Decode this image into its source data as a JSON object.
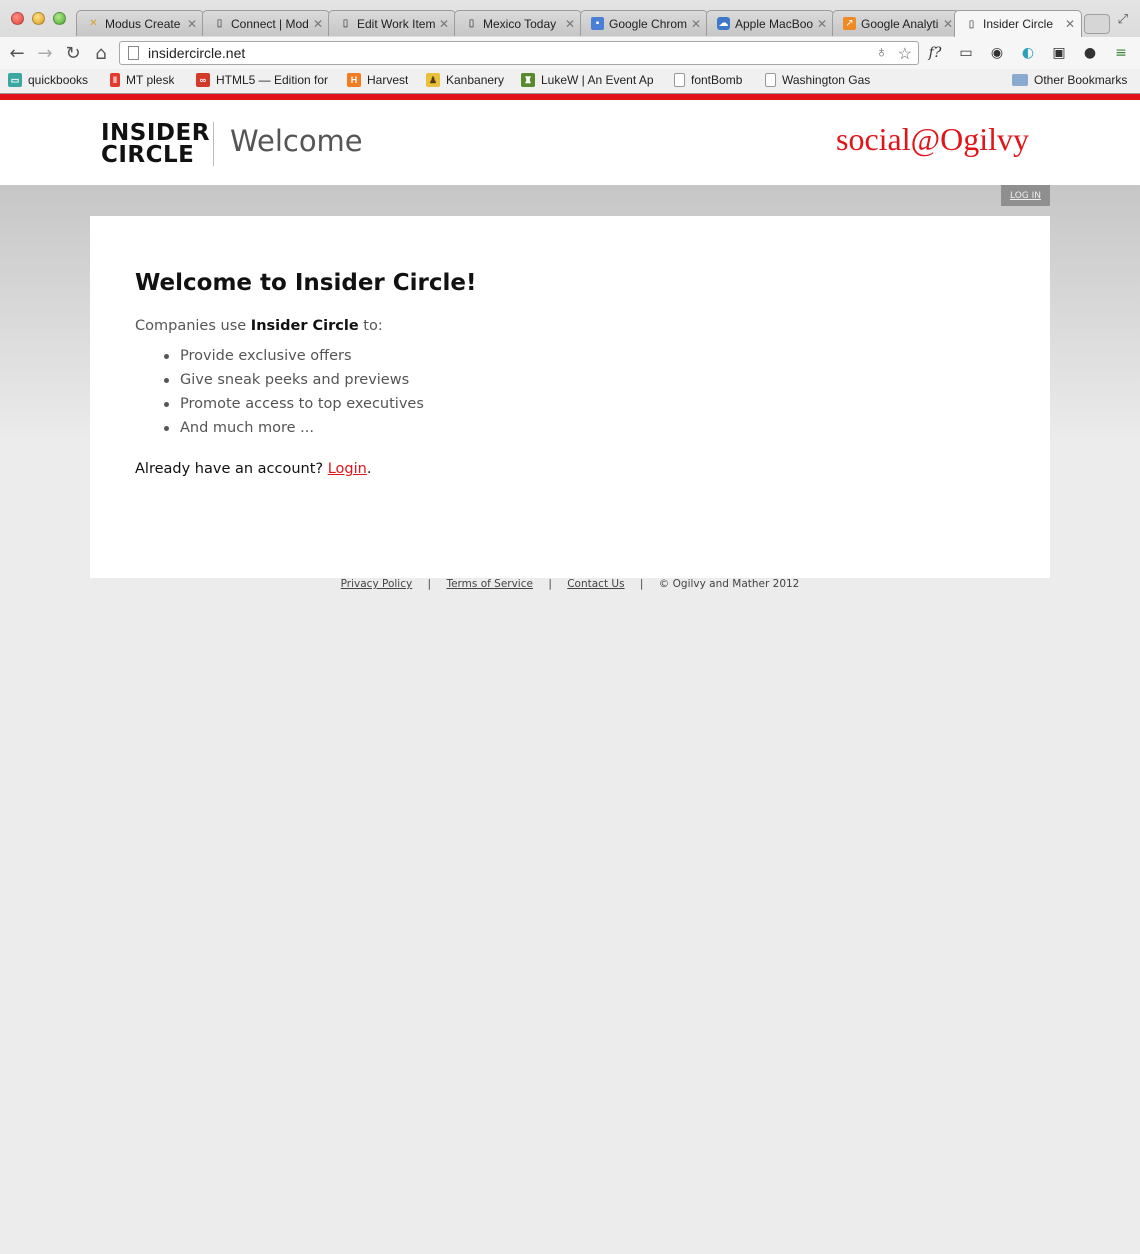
{
  "browser": {
    "tabs": [
      {
        "title": "Modus Create",
        "icon": "modus-favicon-icon"
      },
      {
        "title": "Connect | Mod",
        "icon": "page-icon"
      },
      {
        "title": "Edit Work Item",
        "icon": "page-icon"
      },
      {
        "title": "Mexico Today",
        "icon": "page-icon"
      },
      {
        "title": "Google Chrom",
        "icon": "chrome-store-icon"
      },
      {
        "title": "Apple MacBook",
        "icon": "icloud-icon"
      },
      {
        "title": "Google Analyti",
        "icon": "analytics-icon"
      },
      {
        "title": "Insider Circle",
        "icon": "page-icon"
      }
    ],
    "address": "insidercircle.net",
    "bookmarks": [
      {
        "label": "quickbooks",
        "icon": "quickbooks-icon",
        "color": "#3aa8a0"
      },
      {
        "label": "MT plesk",
        "icon": "plesk-icon",
        "color": "#e23b2e"
      },
      {
        "label": "HTML5 — Edition for",
        "icon": "html5-icon",
        "color": "#d33a2a"
      },
      {
        "label": "Harvest",
        "icon": "harvest-icon",
        "color": "#f47b20"
      },
      {
        "label": "Kanbanery",
        "icon": "kanbanery-icon",
        "color": "#e8c03a"
      },
      {
        "label": "LukeW | An Event Ap",
        "icon": "lukew-icon",
        "color": "#5a8a2e"
      },
      {
        "label": "fontBomb",
        "icon": "page-icon",
        "color": "#ffffff"
      },
      {
        "label": "Washington Gas",
        "icon": "page-icon",
        "color": "#ffffff"
      },
      {
        "label": "Other Bookmarks",
        "icon": "folder-icon",
        "color": "#8aa9cf"
      }
    ]
  },
  "header": {
    "logo_line1": "INSIDER",
    "logo_line2": "CIRCLE",
    "page_title": "Welcome",
    "brand": "social@Ogilvy",
    "accent_color": "#e1141a"
  },
  "login_tab": "LOG IN",
  "content": {
    "heading": "Welcome to Insider Circle!",
    "intro_prefix": "Companies use ",
    "intro_strong": "Insider Circle",
    "intro_suffix": " to:",
    "features": [
      "Provide exclusive offers",
      "Give sneak peeks and previews",
      "Promote access to top executives",
      "And much more ..."
    ],
    "account_prompt": "Already have an account? ",
    "login_link": "Login",
    "account_end": "."
  },
  "footer": {
    "privacy": "Privacy Policy",
    "terms": "Terms of Service",
    "contact": "Contact Us",
    "separator": "|",
    "copyright": "© Ogilvy and Mather 2012"
  }
}
